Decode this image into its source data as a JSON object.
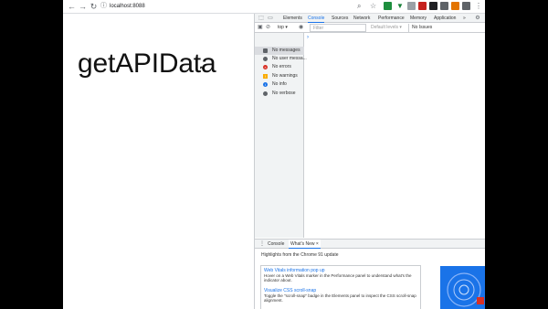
{
  "browser": {
    "url": "localhost:8088"
  },
  "page": {
    "heading": "getAPIData"
  },
  "devtools": {
    "tabs": [
      {
        "label": "Elements",
        "active": false
      },
      {
        "label": "Console",
        "active": true
      },
      {
        "label": "Sources",
        "active": false
      },
      {
        "label": "Network",
        "active": false
      },
      {
        "label": "Performance",
        "active": false
      },
      {
        "label": "Memory",
        "active": false
      },
      {
        "label": "Application",
        "active": false
      }
    ],
    "more_tabs": "»",
    "console_bar": {
      "context": "top ▾",
      "filter_placeholder": "Filter",
      "levels": "Default levels ▾",
      "issues": "No Issues"
    },
    "sidebar": [
      {
        "label": "No messages",
        "icon": "list-icon",
        "color": "#5f6368"
      },
      {
        "label": "No user messa...",
        "icon": "user-icon",
        "color": "#5f6368"
      },
      {
        "label": "No errors",
        "icon": "error-icon",
        "color": "#d93025"
      },
      {
        "label": "No warnings",
        "icon": "warning-icon",
        "color": "#f9ab00"
      },
      {
        "label": "No info",
        "icon": "info-icon",
        "color": "#1a73e8"
      },
      {
        "label": "No verbose",
        "icon": "verbose-icon",
        "color": "#5f6368"
      }
    ],
    "prompt": "›",
    "drawer": {
      "tabs": [
        {
          "label": "Console",
          "active": false
        },
        {
          "label": "What's New",
          "active": true
        }
      ],
      "close_glyph": "×",
      "highlights": "Highlights from the Chrome 91 update",
      "items": [
        {
          "title": "Web Vitals information pop up",
          "desc": "Hover on a Web Vitals marker in the Performance panel to understand what's the indicator about."
        },
        {
          "title": "Visualize CSS scroll-snap",
          "desc": "Toggle the \"scroll-snap\" badge in the Elements panel to inspect the CSS scroll-snap alignment."
        }
      ]
    }
  },
  "colors": {
    "accent": "#1a73e8",
    "panel_bg": "#f1f3f4",
    "border": "#cacdd1"
  }
}
